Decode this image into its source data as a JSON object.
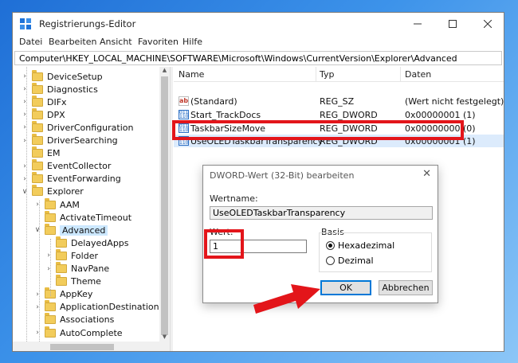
{
  "window": {
    "title": "Registrierungs-Editor"
  },
  "menu": [
    "Datei",
    "Bearbeiten",
    "Ansicht",
    "Favoriten",
    "Hilfe"
  ],
  "address": "Computer\\HKEY_LOCAL_MACHINE\\SOFTWARE\\Microsoft\\Windows\\CurrentVersion\\Explorer\\Advanced",
  "tree": [
    {
      "label": "DeviceSetup",
      "level": 1,
      "exp": "›"
    },
    {
      "label": "Diagnostics",
      "level": 1,
      "exp": "›"
    },
    {
      "label": "DIFx",
      "level": 1,
      "exp": "›"
    },
    {
      "label": "DPX",
      "level": 1,
      "exp": "›"
    },
    {
      "label": "DriverConfiguration",
      "level": 1,
      "exp": "›"
    },
    {
      "label": "DriverSearching",
      "level": 1,
      "exp": "›"
    },
    {
      "label": "EM",
      "level": 1,
      "exp": ""
    },
    {
      "label": "EventCollector",
      "level": 1,
      "exp": "›"
    },
    {
      "label": "EventForwarding",
      "level": 1,
      "exp": "›"
    },
    {
      "label": "Explorer",
      "level": 1,
      "exp": "∨"
    },
    {
      "label": "AAM",
      "level": 2,
      "exp": "›"
    },
    {
      "label": "ActivateTimeout",
      "level": 2,
      "exp": ""
    },
    {
      "label": "Advanced",
      "level": 2,
      "exp": "∨",
      "selected": true
    },
    {
      "label": "DelayedApps",
      "level": 3,
      "exp": ""
    },
    {
      "label": "Folder",
      "level": 3,
      "exp": "›"
    },
    {
      "label": "NavPane",
      "level": 3,
      "exp": "›"
    },
    {
      "label": "Theme",
      "level": 3,
      "exp": ""
    },
    {
      "label": "AppKey",
      "level": 2,
      "exp": "›"
    },
    {
      "label": "ApplicationDestinations",
      "level": 2,
      "exp": "›"
    },
    {
      "label": "Associations",
      "level": 2,
      "exp": ""
    },
    {
      "label": "AutoComplete",
      "level": 2,
      "exp": "›"
    }
  ],
  "list": {
    "columns": [
      "Name",
      "Typ",
      "Daten"
    ],
    "rows": [
      {
        "name": "(Standard)",
        "type": "REG_SZ",
        "data": "(Wert nicht festgelegt)",
        "icon": "string-value-icon"
      },
      {
        "name": "Start_TrackDocs",
        "type": "REG_DWORD",
        "data": "0x00000001 (1)",
        "icon": "binary-value-icon"
      },
      {
        "name": "TaskbarSizeMove",
        "type": "REG_DWORD",
        "data": "0x00000000 (0)",
        "icon": "binary-value-icon"
      },
      {
        "name": "UseOLEDTaskbarTransparency",
        "type": "REG_DWORD",
        "data": "0x00000001 (1)",
        "icon": "binary-value-icon",
        "selected": true
      }
    ]
  },
  "dialog": {
    "title": "DWORD-Wert (32-Bit) bearbeiten",
    "name_label": "Wertname:",
    "name_value": "UseOLEDTaskbarTransparency",
    "value_label": "Wert:",
    "value": "1",
    "base_label": "Basis",
    "radio_hex": "Hexadezimal",
    "radio_dec": "Dezimal",
    "ok": "OK",
    "cancel": "Abbrechen"
  },
  "colors": {
    "highlight": "#e3151a",
    "selection": "#cce8ff",
    "accent": "#0078d7"
  }
}
